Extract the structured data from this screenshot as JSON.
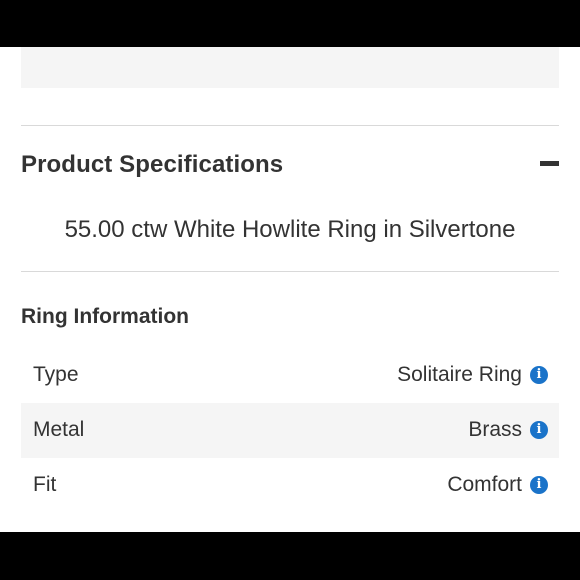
{
  "product_specifications": {
    "title": "Product Specifications",
    "collapse_icon": "minus-icon",
    "product_name": "55.00 ctw White Howlite Ring in Silvertone"
  },
  "ring_information": {
    "title": "Ring Information",
    "rows": [
      {
        "label": "Type",
        "value": "Solitaire Ring",
        "info_icon": "info-icon",
        "info_glyph": "i"
      },
      {
        "label": "Metal",
        "value": "Brass",
        "info_icon": "info-icon",
        "info_glyph": "i"
      },
      {
        "label": "Fit",
        "value": "Comfort",
        "info_icon": "info-icon",
        "info_glyph": "i"
      }
    ]
  },
  "colors": {
    "accent": "#1a73c9",
    "text": "#333333",
    "row_shade": "#f5f5f5",
    "divider": "#d9d9d9"
  }
}
